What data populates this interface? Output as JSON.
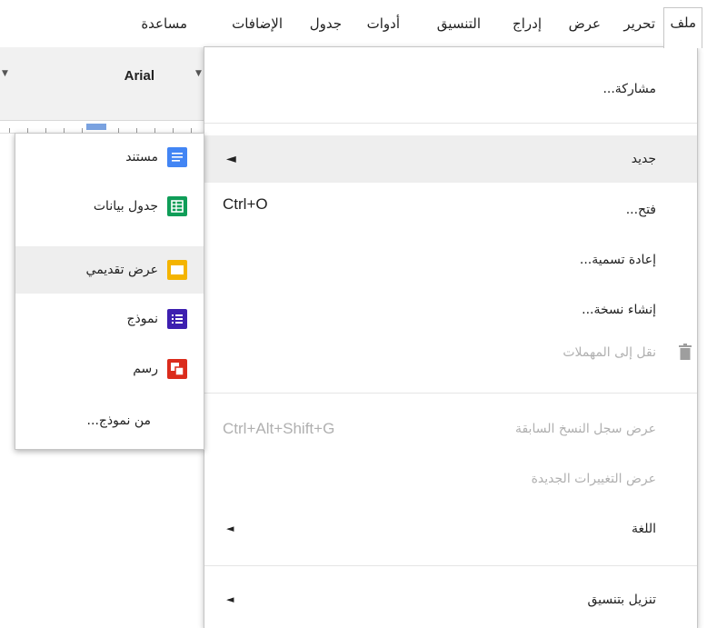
{
  "menubar": {
    "items": [
      "ملف",
      "تحرير",
      "عرض",
      "إدراج",
      "التنسيق",
      "أدوات",
      "جدول",
      "الإضافات",
      "مساعدة"
    ],
    "active_index": 0
  },
  "toolbar": {
    "font_name": "Arial"
  },
  "file_menu": {
    "share": "مشاركة...",
    "new": "جديد",
    "open": "فتح...",
    "open_shortcut": "Ctrl+O",
    "rename": "إعادة تسمية...",
    "make_copy": "إنشاء نسخة...",
    "move_to_trash": "نقل إلى المهملات",
    "revision_history": "عرض سجل النسخ السابقة",
    "revision_shortcut": "Ctrl+Alt+Shift+G",
    "see_new_changes": "عرض التغييرات الجديدة",
    "language": "اللغة",
    "download_as": "تنزيل بتنسيق"
  },
  "new_submenu": {
    "items": [
      {
        "label": "مستند",
        "icon": "document-icon",
        "color": "#4285f4"
      },
      {
        "label": "جدول بيانات",
        "icon": "spreadsheet-icon",
        "color": "#0f9d58"
      },
      {
        "label": "عرض تقديمي",
        "icon": "presentation-icon",
        "color": "#f4b400"
      },
      {
        "label": "نموذج",
        "icon": "form-icon",
        "color": "#3d1fb0"
      },
      {
        "label": "رسم",
        "icon": "drawing-icon",
        "color": "#db2c1c"
      }
    ],
    "from_template": "من نموذج..."
  }
}
